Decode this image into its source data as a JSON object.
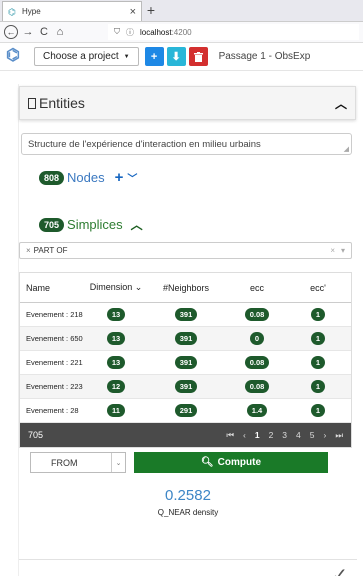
{
  "browser": {
    "tab_title": "Hype",
    "tab_close": "×",
    "new_tab": "+",
    "url_host": "localhost",
    "url_port": ":4200",
    "back": "←",
    "forward": "→",
    "reload": "C",
    "home": "⌂"
  },
  "toolbar": {
    "project_select": "Choose a project",
    "add": "+",
    "download": "⬇",
    "delete": "🗑",
    "passage": "Passage 1 - ObsExp"
  },
  "entities": {
    "title": "Entities"
  },
  "description": "Structure de l'expérience d'interaction en milieu urbains",
  "nodes": {
    "count": "808",
    "label": "Nodes"
  },
  "simplices": {
    "count": "705",
    "label": "Simplices"
  },
  "filter": {
    "tag": "PART OF",
    "clear": "×",
    "dropdown": "▾"
  },
  "table": {
    "headers": [
      "Name",
      "Dimension",
      "#Neighbors",
      "ecc",
      "ecc'"
    ],
    "rows": [
      [
        "Evenement : 218",
        "13",
        "391",
        "0.08",
        "1"
      ],
      [
        "Evenement : 650",
        "13",
        "391",
        "0",
        "1"
      ],
      [
        "Evenement : 221",
        "13",
        "391",
        "0.08",
        "1"
      ],
      [
        "Evenement : 223",
        "12",
        "391",
        "0.08",
        "1"
      ],
      [
        "Evenement : 28",
        "11",
        "291",
        "1.4",
        "1"
      ]
    ],
    "total": "705",
    "pages": [
      "1",
      "2",
      "3",
      "4",
      "5"
    ],
    "current_page": "1"
  },
  "controls": {
    "select_value": "FROM",
    "compute_label": "Compute"
  },
  "result": {
    "value": "0.2582",
    "label": "Q_NEAR density"
  }
}
